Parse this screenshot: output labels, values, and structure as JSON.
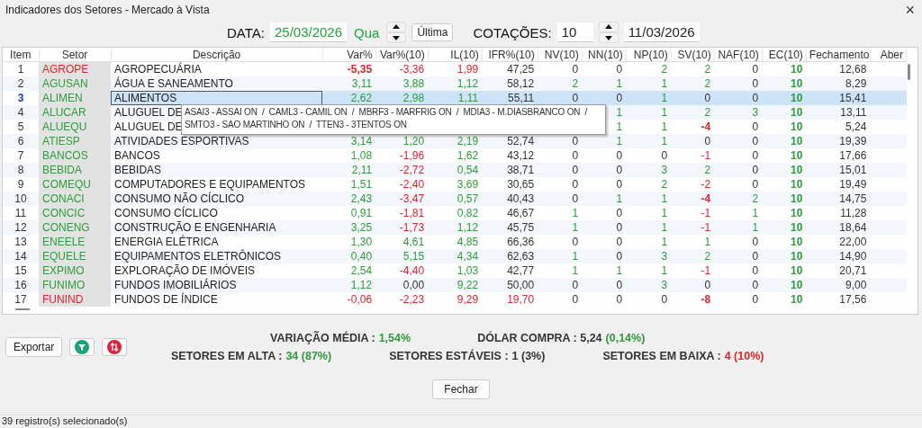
{
  "window": {
    "title": "Indicadores dos Setores - Mercado à Vista",
    "close": "×"
  },
  "toolbar": {
    "date_label": "DATA:",
    "date": "25/03/2026",
    "weekday": "Qua",
    "last_button": "Última",
    "quotes_label": "COTAÇÕES:",
    "quotes": "10",
    "quotes_date": "11/03/2026"
  },
  "table": {
    "columns": [
      "Item",
      "Setor",
      "Descrição",
      "Var%",
      "Var%(10)",
      "IL(10)",
      "IFR%(10)",
      "NV(10)",
      "NN(10)",
      "NP(10)",
      "SV(10)",
      "NAF(10)",
      "EC(10)",
      "Fechamento",
      "Aber"
    ],
    "rows": [
      {
        "item": "1",
        "selected": false,
        "sector": {
          "text": "AGROPE",
          "color": "#e1242c"
        },
        "description": "AGROPECUÁRIA",
        "values": {
          "var": {
            "text": "-5,35",
            "color": "#e1242c",
            "bold": true
          },
          "var10": {
            "text": "-3,36",
            "color": "#e1242c",
            "bold": false
          },
          "il": {
            "text": "1,99",
            "color": "#e1242c",
            "bold": false
          },
          "ifr": {
            "text": "47,25",
            "color": "#333333",
            "bold": false
          },
          "nv": {
            "text": "0",
            "color": "#333333",
            "bold": false
          },
          "nn": {
            "text": "0",
            "color": "#333333",
            "bold": false
          },
          "np": {
            "text": "2",
            "color": "#2e9b3c",
            "bold": false
          },
          "sv": {
            "text": "2",
            "color": "#2e9b3c",
            "bold": false
          },
          "naf": {
            "text": "0",
            "color": "#333333",
            "bold": false
          },
          "ec": {
            "text": "10",
            "color": "#2e9b3c",
            "bold": true
          },
          "close": {
            "text": "12,68",
            "color": "#333333",
            "bold": false
          }
        }
      },
      {
        "item": "2",
        "selected": false,
        "sector": {
          "text": "AGUSAN",
          "color": "#2e9b3c"
        },
        "description": "ÁGUA E SANEAMENTO",
        "values": {
          "var": {
            "text": "3,11",
            "color": "#2e9b3c",
            "bold": false
          },
          "var10": {
            "text": "3,88",
            "color": "#2e9b3c",
            "bold": false
          },
          "il": {
            "text": "1,12",
            "color": "#2e9b3c",
            "bold": false
          },
          "ifr": {
            "text": "58,12",
            "color": "#333333",
            "bold": false
          },
          "nv": {
            "text": "2",
            "color": "#2e9b3c",
            "bold": false
          },
          "nn": {
            "text": "1",
            "color": "#2e9b3c",
            "bold": false
          },
          "np": {
            "text": "1",
            "color": "#2e9b3c",
            "bold": false
          },
          "sv": {
            "text": "2",
            "color": "#2e9b3c",
            "bold": false
          },
          "naf": {
            "text": "0",
            "color": "#333333",
            "bold": false
          },
          "ec": {
            "text": "10",
            "color": "#2e9b3c",
            "bold": true
          },
          "close": {
            "text": "8,29",
            "color": "#333333",
            "bold": false
          }
        }
      },
      {
        "item": "3",
        "selected": true,
        "sector": {
          "text": "ALIMEN",
          "color": "#2e9b3c"
        },
        "description": "ALIMENTOS",
        "values": {
          "var": {
            "text": "2,62",
            "color": "#2e9b3c",
            "bold": false
          },
          "var10": {
            "text": "2,98",
            "color": "#2e9b3c",
            "bold": false
          },
          "il": {
            "text": "1,11",
            "color": "#2e9b3c",
            "bold": false
          },
          "ifr": {
            "text": "55,11",
            "color": "#333333",
            "bold": false
          },
          "nv": {
            "text": "0",
            "color": "#333333",
            "bold": false
          },
          "nn": {
            "text": "0",
            "color": "#333333",
            "bold": false
          },
          "np": {
            "text": "1",
            "color": "#2e9b3c",
            "bold": false
          },
          "sv": {
            "text": "0",
            "color": "#333333",
            "bold": false
          },
          "naf": {
            "text": "0",
            "color": "#333333",
            "bold": false
          },
          "ec": {
            "text": "10",
            "color": "#2e9b3c",
            "bold": true
          },
          "close": {
            "text": "15,41",
            "color": "#333333",
            "bold": false
          }
        }
      },
      {
        "item": "4",
        "selected": false,
        "sector": {
          "text": "ALUCAR",
          "color": "#2e9b3c"
        },
        "description": "ALUGUEL DE",
        "values": {
          "nn": {
            "text": "1",
            "color": "#2e9b3c",
            "bold": false
          },
          "np": {
            "text": "1",
            "color": "#2e9b3c",
            "bold": false
          },
          "sv": {
            "text": "2",
            "color": "#2e9b3c",
            "bold": false
          },
          "naf": {
            "text": "3",
            "color": "#2e9b3c",
            "bold": false
          },
          "ec": {
            "text": "10",
            "color": "#2e9b3c",
            "bold": true
          },
          "close": {
            "text": "13,11",
            "color": "#333333",
            "bold": false
          }
        }
      },
      {
        "item": "5",
        "selected": false,
        "sector": {
          "text": "ALUEQU",
          "color": "#2e9b3c"
        },
        "description": "ALUGUEL DE",
        "values": {
          "nn": {
            "text": "1",
            "color": "#2e9b3c",
            "bold": false
          },
          "np": {
            "text": "1",
            "color": "#2e9b3c",
            "bold": false
          },
          "sv": {
            "text": "-4",
            "color": "#e1242c",
            "bold": true
          },
          "naf": {
            "text": "0",
            "color": "#333333",
            "bold": false
          },
          "ec": {
            "text": "10",
            "color": "#2e9b3c",
            "bold": true
          },
          "close": {
            "text": "5,24",
            "color": "#333333",
            "bold": false
          }
        }
      },
      {
        "item": "6",
        "selected": false,
        "sector": {
          "text": "ATIESP",
          "color": "#2e9b3c"
        },
        "description": "ATIVIDADES ESPORTIVAS",
        "values": {
          "var": {
            "text": "3,14",
            "color": "#2e9b3c",
            "bold": false
          },
          "var10": {
            "text": "1,20",
            "color": "#2e9b3c",
            "bold": false
          },
          "il": {
            "text": "2,19",
            "color": "#2e9b3c",
            "bold": false
          },
          "ifr": {
            "text": "52,74",
            "color": "#333333",
            "bold": false
          },
          "nv": {
            "text": "0",
            "color": "#333333",
            "bold": false
          },
          "nn": {
            "text": "1",
            "color": "#2e9b3c",
            "bold": false
          },
          "np": {
            "text": "1",
            "color": "#2e9b3c",
            "bold": false
          },
          "sv": {
            "text": "0",
            "color": "#333333",
            "bold": false
          },
          "naf": {
            "text": "0",
            "color": "#333333",
            "bold": false
          },
          "ec": {
            "text": "10",
            "color": "#2e9b3c",
            "bold": true
          },
          "close": {
            "text": "19,39",
            "color": "#333333",
            "bold": false
          }
        }
      },
      {
        "item": "7",
        "selected": false,
        "sector": {
          "text": "BANCOS",
          "color": "#2e9b3c"
        },
        "description": "BANCOS",
        "values": {
          "var": {
            "text": "1,08",
            "color": "#2e9b3c",
            "bold": false
          },
          "var10": {
            "text": "-1,96",
            "color": "#e1242c",
            "bold": false
          },
          "il": {
            "text": "1,62",
            "color": "#2e9b3c",
            "bold": false
          },
          "ifr": {
            "text": "43,12",
            "color": "#333333",
            "bold": false
          },
          "nv": {
            "text": "0",
            "color": "#333333",
            "bold": false
          },
          "nn": {
            "text": "0",
            "color": "#333333",
            "bold": false
          },
          "np": {
            "text": "0",
            "color": "#333333",
            "bold": false
          },
          "sv": {
            "text": "-1",
            "color": "#e1242c",
            "bold": false
          },
          "naf": {
            "text": "0",
            "color": "#333333",
            "bold": false
          },
          "ec": {
            "text": "10",
            "color": "#2e9b3c",
            "bold": true
          },
          "close": {
            "text": "17,66",
            "color": "#333333",
            "bold": false
          }
        }
      },
      {
        "item": "8",
        "selected": false,
        "sector": {
          "text": "BEBIDA",
          "color": "#2e9b3c"
        },
        "description": "BEBIDAS",
        "values": {
          "var": {
            "text": "2,11",
            "color": "#2e9b3c",
            "bold": false
          },
          "var10": {
            "text": "-2,72",
            "color": "#e1242c",
            "bold": false
          },
          "il": {
            "text": "0,54",
            "color": "#2e9b3c",
            "bold": false
          },
          "ifr": {
            "text": "38,71",
            "color": "#333333",
            "bold": false
          },
          "nv": {
            "text": "0",
            "color": "#333333",
            "bold": false
          },
          "nn": {
            "text": "0",
            "color": "#333333",
            "bold": false
          },
          "np": {
            "text": "3",
            "color": "#2e9b3c",
            "bold": false
          },
          "sv": {
            "text": "2",
            "color": "#2e9b3c",
            "bold": false
          },
          "naf": {
            "text": "0",
            "color": "#333333",
            "bold": false
          },
          "ec": {
            "text": "10",
            "color": "#2e9b3c",
            "bold": true
          },
          "close": {
            "text": "15,01",
            "color": "#333333",
            "bold": false
          }
        }
      },
      {
        "item": "9",
        "selected": false,
        "sector": {
          "text": "COMEQU",
          "color": "#2e9b3c"
        },
        "description": "COMPUTADORES E EQUIPAMENTOS",
        "values": {
          "var": {
            "text": "1,51",
            "color": "#2e9b3c",
            "bold": false
          },
          "var10": {
            "text": "-2,40",
            "color": "#e1242c",
            "bold": false
          },
          "il": {
            "text": "3,69",
            "color": "#2e9b3c",
            "bold": false
          },
          "ifr": {
            "text": "30,65",
            "color": "#333333",
            "bold": false
          },
          "nv": {
            "text": "0",
            "color": "#333333",
            "bold": false
          },
          "nn": {
            "text": "0",
            "color": "#333333",
            "bold": false
          },
          "np": {
            "text": "2",
            "color": "#2e9b3c",
            "bold": false
          },
          "sv": {
            "text": "-2",
            "color": "#e1242c",
            "bold": false
          },
          "naf": {
            "text": "0",
            "color": "#333333",
            "bold": false
          },
          "ec": {
            "text": "10",
            "color": "#2e9b3c",
            "bold": true
          },
          "close": {
            "text": "19,49",
            "color": "#333333",
            "bold": false
          }
        }
      },
      {
        "item": "10",
        "selected": false,
        "sector": {
          "text": "CONACI",
          "color": "#2e9b3c"
        },
        "description": "CONSUMO NÃO CÍCLICO",
        "values": {
          "var": {
            "text": "2,43",
            "color": "#2e9b3c",
            "bold": false
          },
          "var10": {
            "text": "-3,47",
            "color": "#e1242c",
            "bold": false
          },
          "il": {
            "text": "0,57",
            "color": "#2e9b3c",
            "bold": false
          },
          "ifr": {
            "text": "40,43",
            "color": "#333333",
            "bold": false
          },
          "nv": {
            "text": "0",
            "color": "#333333",
            "bold": false
          },
          "nn": {
            "text": "1",
            "color": "#2e9b3c",
            "bold": false
          },
          "np": {
            "text": "1",
            "color": "#2e9b3c",
            "bold": false
          },
          "sv": {
            "text": "-4",
            "color": "#e1242c",
            "bold": true
          },
          "naf": {
            "text": "2",
            "color": "#2e9b3c",
            "bold": false
          },
          "ec": {
            "text": "10",
            "color": "#2e9b3c",
            "bold": true
          },
          "close": {
            "text": "14,75",
            "color": "#333333",
            "bold": false
          }
        }
      },
      {
        "item": "11",
        "selected": false,
        "sector": {
          "text": "CONCIC",
          "color": "#2e9b3c"
        },
        "description": "CONSUMO CÍCLICO",
        "values": {
          "var": {
            "text": "0,91",
            "color": "#2e9b3c",
            "bold": false
          },
          "var10": {
            "text": "-1,81",
            "color": "#e1242c",
            "bold": false
          },
          "il": {
            "text": "0,82",
            "color": "#2e9b3c",
            "bold": false
          },
          "ifr": {
            "text": "46,67",
            "color": "#333333",
            "bold": false
          },
          "nv": {
            "text": "1",
            "color": "#2e9b3c",
            "bold": false
          },
          "nn": {
            "text": "0",
            "color": "#333333",
            "bold": false
          },
          "np": {
            "text": "1",
            "color": "#2e9b3c",
            "bold": false
          },
          "sv": {
            "text": "-1",
            "color": "#e1242c",
            "bold": false
          },
          "naf": {
            "text": "1",
            "color": "#2e9b3c",
            "bold": false
          },
          "ec": {
            "text": "10",
            "color": "#2e9b3c",
            "bold": true
          },
          "close": {
            "text": "11,28",
            "color": "#333333",
            "bold": false
          }
        }
      },
      {
        "item": "12",
        "selected": false,
        "sector": {
          "text": "CONENG",
          "color": "#2e9b3c"
        },
        "description": "CONSTRUÇÃO E ENGENHARIA",
        "values": {
          "var": {
            "text": "3,25",
            "color": "#2e9b3c",
            "bold": false
          },
          "var10": {
            "text": "-1,73",
            "color": "#e1242c",
            "bold": false
          },
          "il": {
            "text": "1,12",
            "color": "#2e9b3c",
            "bold": false
          },
          "ifr": {
            "text": "45,75",
            "color": "#333333",
            "bold": false
          },
          "nv": {
            "text": "1",
            "color": "#2e9b3c",
            "bold": false
          },
          "nn": {
            "text": "0",
            "color": "#333333",
            "bold": false
          },
          "np": {
            "text": "1",
            "color": "#2e9b3c",
            "bold": false
          },
          "sv": {
            "text": "-1",
            "color": "#e1242c",
            "bold": false
          },
          "naf": {
            "text": "1",
            "color": "#2e9b3c",
            "bold": false
          },
          "ec": {
            "text": "10",
            "color": "#2e9b3c",
            "bold": true
          },
          "close": {
            "text": "18,64",
            "color": "#333333",
            "bold": false
          }
        }
      },
      {
        "item": "13",
        "selected": false,
        "sector": {
          "text": "ENEELE",
          "color": "#2e9b3c"
        },
        "description": "ENERGIA ELÉTRICA",
        "values": {
          "var": {
            "text": "1,30",
            "color": "#2e9b3c",
            "bold": false
          },
          "var10": {
            "text": "4,61",
            "color": "#2e9b3c",
            "bold": false
          },
          "il": {
            "text": "4,85",
            "color": "#2e9b3c",
            "bold": false
          },
          "ifr": {
            "text": "66,36",
            "color": "#333333",
            "bold": false
          },
          "nv": {
            "text": "0",
            "color": "#333333",
            "bold": false
          },
          "nn": {
            "text": "0",
            "color": "#333333",
            "bold": false
          },
          "np": {
            "text": "1",
            "color": "#2e9b3c",
            "bold": false
          },
          "sv": {
            "text": "1",
            "color": "#2e9b3c",
            "bold": false
          },
          "naf": {
            "text": "0",
            "color": "#333333",
            "bold": false
          },
          "ec": {
            "text": "10",
            "color": "#2e9b3c",
            "bold": true
          },
          "close": {
            "text": "22,00",
            "color": "#333333",
            "bold": false
          }
        }
      },
      {
        "item": "14",
        "selected": false,
        "sector": {
          "text": "EQUELE",
          "color": "#2e9b3c"
        },
        "description": "EQUIPAMENTOS ELETRÔNICOS",
        "values": {
          "var": {
            "text": "0,40",
            "color": "#2e9b3c",
            "bold": false
          },
          "var10": {
            "text": "5,15",
            "color": "#2e9b3c",
            "bold": false
          },
          "il": {
            "text": "4,34",
            "color": "#2e9b3c",
            "bold": false
          },
          "ifr": {
            "text": "62,63",
            "color": "#333333",
            "bold": false
          },
          "nv": {
            "text": "1",
            "color": "#2e9b3c",
            "bold": false
          },
          "nn": {
            "text": "0",
            "color": "#333333",
            "bold": false
          },
          "np": {
            "text": "3",
            "color": "#2e9b3c",
            "bold": false
          },
          "sv": {
            "text": "2",
            "color": "#2e9b3c",
            "bold": false
          },
          "naf": {
            "text": "0",
            "color": "#333333",
            "bold": false
          },
          "ec": {
            "text": "10",
            "color": "#2e9b3c",
            "bold": true
          },
          "close": {
            "text": "14,90",
            "color": "#333333",
            "bold": false
          }
        }
      },
      {
        "item": "15",
        "selected": false,
        "sector": {
          "text": "EXPIMO",
          "color": "#2e9b3c"
        },
        "description": "EXPLORAÇÃO DE IMÓVEIS",
        "values": {
          "var": {
            "text": "2,54",
            "color": "#2e9b3c",
            "bold": false
          },
          "var10": {
            "text": "-4,40",
            "color": "#e1242c",
            "bold": false
          },
          "il": {
            "text": "1,03",
            "color": "#2e9b3c",
            "bold": false
          },
          "ifr": {
            "text": "42,77",
            "color": "#333333",
            "bold": false
          },
          "nv": {
            "text": "1",
            "color": "#2e9b3c",
            "bold": false
          },
          "nn": {
            "text": "1",
            "color": "#2e9b3c",
            "bold": false
          },
          "np": {
            "text": "1",
            "color": "#2e9b3c",
            "bold": false
          },
          "sv": {
            "text": "-1",
            "color": "#e1242c",
            "bold": false
          },
          "naf": {
            "text": "0",
            "color": "#333333",
            "bold": false
          },
          "ec": {
            "text": "10",
            "color": "#2e9b3c",
            "bold": true
          },
          "close": {
            "text": "20,71",
            "color": "#333333",
            "bold": false
          }
        }
      },
      {
        "item": "16",
        "selected": false,
        "sector": {
          "text": "FUNIMO",
          "color": "#2e9b3c"
        },
        "description": "FUNDOS IMOBILIÁRIOS",
        "values": {
          "var": {
            "text": "1,12",
            "color": "#2e9b3c",
            "bold": false
          },
          "var10": {
            "text": "0,00",
            "color": "#333333",
            "bold": false
          },
          "il": {
            "text": "9,22",
            "color": "#2e9b3c",
            "bold": false
          },
          "ifr": {
            "text": "50,00",
            "color": "#333333",
            "bold": false
          },
          "nv": {
            "text": "0",
            "color": "#333333",
            "bold": false
          },
          "nn": {
            "text": "0",
            "color": "#333333",
            "bold": false
          },
          "np": {
            "text": "3",
            "color": "#2e9b3c",
            "bold": false
          },
          "sv": {
            "text": "0",
            "color": "#333333",
            "bold": false
          },
          "naf": {
            "text": "0",
            "color": "#333333",
            "bold": false
          },
          "ec": {
            "text": "10",
            "color": "#2e9b3c",
            "bold": true
          },
          "close": {
            "text": "9,00",
            "color": "#333333",
            "bold": false
          }
        }
      },
      {
        "item": "17",
        "selected": false,
        "sector": {
          "text": "FUNIND",
          "color": "#e1242c"
        },
        "description": "FUNDOS DE ÍNDICE",
        "values": {
          "var": {
            "text": "-0,06",
            "color": "#e1242c",
            "bold": false
          },
          "var10": {
            "text": "-2,23",
            "color": "#e1242c",
            "bold": false
          },
          "il": {
            "text": "9,29",
            "color": "#e1242c",
            "bold": false
          },
          "ifr": {
            "text": "19,70",
            "color": "#e1242c",
            "bold": false
          },
          "nv": {
            "text": "0",
            "color": "#333333",
            "bold": false
          },
          "nn": {
            "text": "0",
            "color": "#333333",
            "bold": false
          },
          "np": {
            "text": "0",
            "color": "#333333",
            "bold": false
          },
          "sv": {
            "text": "-8",
            "color": "#e1242c",
            "bold": true
          },
          "naf": {
            "text": "0",
            "color": "#333333",
            "bold": false
          },
          "ec": {
            "text": "10",
            "color": "#2e9b3c",
            "bold": true
          },
          "close": {
            "text": "17,56",
            "color": "#333333",
            "bold": false
          }
        }
      }
    ]
  },
  "tooltip": {
    "lines": [
      "ASAI3 - ASSAI ON  /  CAML3 - CAMIL ON  /  MBRF3 - MARFRIG ON  /  MDIA3 - M.DIASBRANCO ON  /",
      "SMTO3 - SAO MARTINHO ON  /  TTEN3 - 3TENTOS ON"
    ]
  },
  "summary": {
    "top": [
      {
        "label": "VARIAÇÃO MÉDIA :",
        "value": "1,54%",
        "color": "#2e9b3c"
      },
      {
        "label": "DÓLAR COMPRA : 5,24",
        "value": "(0,14%)",
        "color": "#2e9b3c"
      }
    ],
    "bottom": [
      {
        "label": "SETORES EM ALTA :",
        "value": "34 (87%)",
        "color": "#2e9b3c"
      },
      {
        "label": "SETORES ESTÁVEIS :",
        "value": "1 (3%)",
        "color": "#333333"
      },
      {
        "label": "SETORES EM BAIXA :",
        "value": "4 (10%)",
        "color": "#e1242c"
      }
    ]
  },
  "export_button": "Exportar",
  "close_button": "Fechar",
  "status_bar": "39 registro(s) selecionado(s)"
}
